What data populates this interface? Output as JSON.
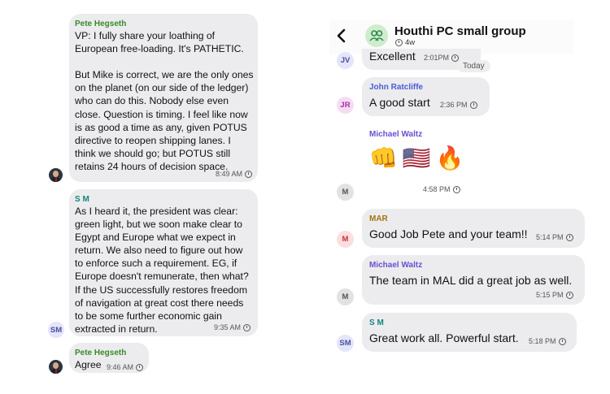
{
  "colors": {
    "bubble": "#ececee",
    "pete": "#3a8a29",
    "sm": "#13867e",
    "john": "#4a5bd6",
    "waltz": "#6b4fd1",
    "mar": "#a27414",
    "header_green": "#2e8b4c"
  },
  "left": {
    "messages": [
      {
        "sender": "Pete Hegseth",
        "lines": [
          "VP: I fully share your loathing of",
          "European free-loading. It's PATHETIC.",
          "",
          "But Mike is correct, we are the only ones",
          "on the planet (on our side of the ledger)",
          "who can do this. Nobody else even",
          "close. Question is timing. I feel like now",
          "is as good a time as any, given POTUS",
          "directive to reopen shipping lanes. I",
          "think we should go; but POTUS still",
          "retains 24 hours of decision space."
        ],
        "time": "8:49 AM"
      },
      {
        "sender": "S M",
        "avatar": "SM",
        "lines": [
          "As I heard it, the president was clear:",
          "green light, but we soon make clear to",
          "Egypt and Europe what we expect in",
          "return. We also need to figure out how",
          "to enforce such a requirement. EG, if",
          "Europe doesn't remunerate, then what?",
          "If the US successfully restores freedom",
          "of navigation at great cost there needs",
          "to be some further economic gain",
          "extracted in return."
        ],
        "time": "9:35 AM"
      },
      {
        "sender": "Pete Hegseth",
        "text": "Agree",
        "time": "9:46 AM"
      }
    ]
  },
  "right": {
    "header": {
      "back_icon": "chevron-left-icon",
      "group_icon": "group-people-icon",
      "title": "Houthi PC small group",
      "subtitle": "4w",
      "subtitle_icon": "timer-icon"
    },
    "messages": [
      {
        "avatar": "JV",
        "text": "Excellent",
        "time": "2:01PM",
        "badge": "Today"
      },
      {
        "avatar": "JR",
        "sender": "John Ratcliffe",
        "text": "A good start",
        "time": "2:36 PM"
      },
      {
        "avatar": "M",
        "sender": "Michael Waltz",
        "emojis": [
          "👊",
          "🇺🇸",
          "🔥"
        ],
        "time": "4:58 PM"
      },
      {
        "avatar": "M",
        "sender": "MAR",
        "text": "Good Job Pete and your team!!",
        "time": "5:14 PM"
      },
      {
        "avatar": "M",
        "sender": "Michael Waltz",
        "text": "The team in MAL did a great job  as well.",
        "time": "5:15 PM"
      },
      {
        "avatar": "SM",
        "sender": "S M",
        "text": "Great work all. Powerful start.",
        "time": "5:18 PM"
      }
    ]
  }
}
